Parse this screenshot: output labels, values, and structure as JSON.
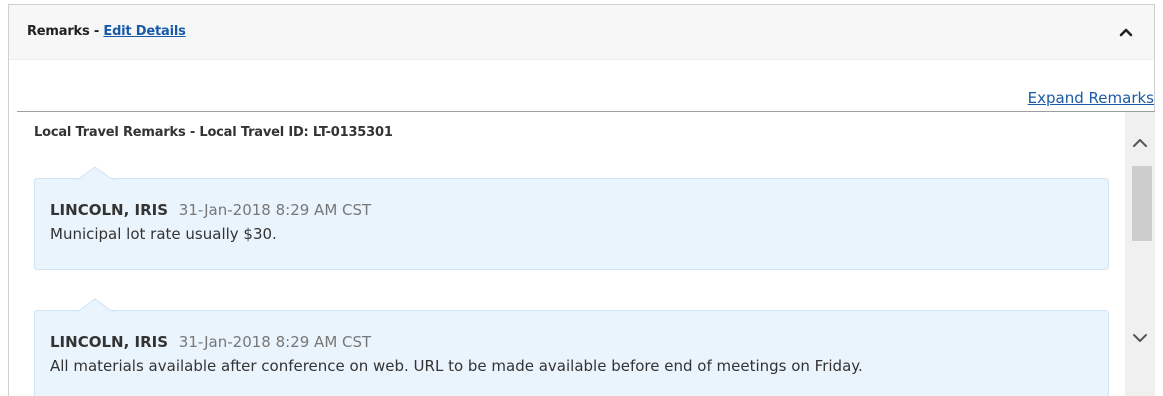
{
  "panel": {
    "title": "Remarks - ",
    "edit_link": "Edit Details",
    "collapse_icon": "chevron-up-icon"
  },
  "expand_link": "Expand Remarks",
  "remarks_section": {
    "heading": "Local Travel Remarks - Local Travel ID: LT-0135301",
    "items": [
      {
        "author": "LINCOLN, IRIS",
        "timestamp": "31-Jan-2018 8:29 AM CST",
        "text": "Municipal lot rate usually $30."
      },
      {
        "author": "LINCOLN, IRIS",
        "timestamp": "31-Jan-2018 8:29 AM CST",
        "text": "All materials available after conference on web. URL to be made available before end of meetings on Friday."
      }
    ]
  },
  "scrollbar": {
    "up_icon": "chevron-up-icon",
    "down_icon": "chevron-down-icon"
  },
  "colors": {
    "link": "#1a5aa6",
    "remark_bg": "#eaf4fd",
    "remark_border": "#cfe3f6",
    "header_bg": "#f7f7f7"
  }
}
